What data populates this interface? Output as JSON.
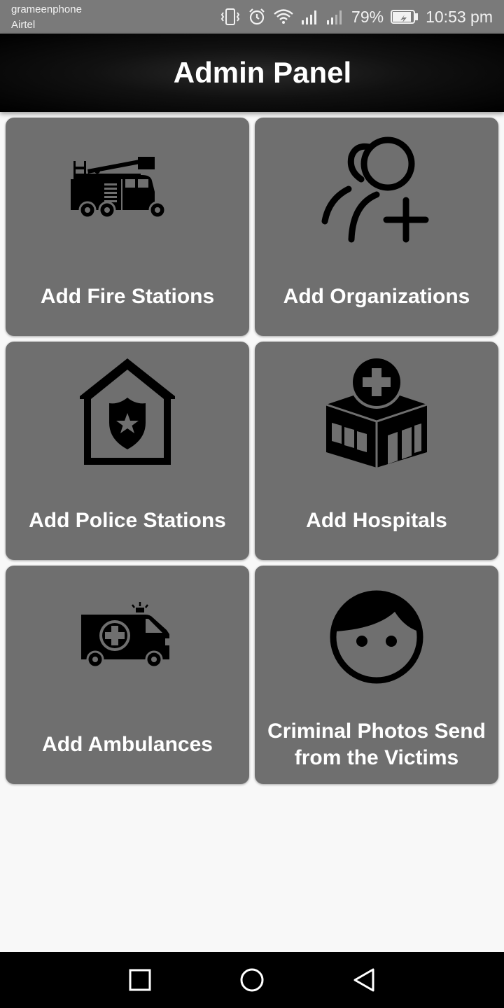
{
  "status_bar": {
    "carrier_1": "grameenphone",
    "carrier_2": "Airtel",
    "battery": "79%",
    "time": "10:53 pm",
    "icons": [
      "vibrate-icon",
      "alarm-icon",
      "wifi-icon",
      "signal-icon",
      "signal-icon",
      "battery-icon"
    ]
  },
  "header": {
    "title": "Admin Panel"
  },
  "tiles": [
    {
      "label": "Add Fire Stations",
      "icon": "fire-truck-icon"
    },
    {
      "label": "Add Organizations",
      "icon": "add-user-icon"
    },
    {
      "label": "Add Police Stations",
      "icon": "police-station-icon"
    },
    {
      "label": "Add Hospitals",
      "icon": "hospital-icon"
    },
    {
      "label": "Add Ambulances",
      "icon": "ambulance-icon"
    },
    {
      "label": "Criminal Photos Send from the Victims",
      "icon": "face-icon"
    }
  ],
  "nav": {
    "icons": [
      "recent-apps-icon",
      "home-icon",
      "back-icon"
    ]
  },
  "colors": {
    "tile": "#6f6f6f",
    "app_bar": "#000000",
    "status_bar": "#7a7a7a",
    "background": "#f8f8f8"
  }
}
